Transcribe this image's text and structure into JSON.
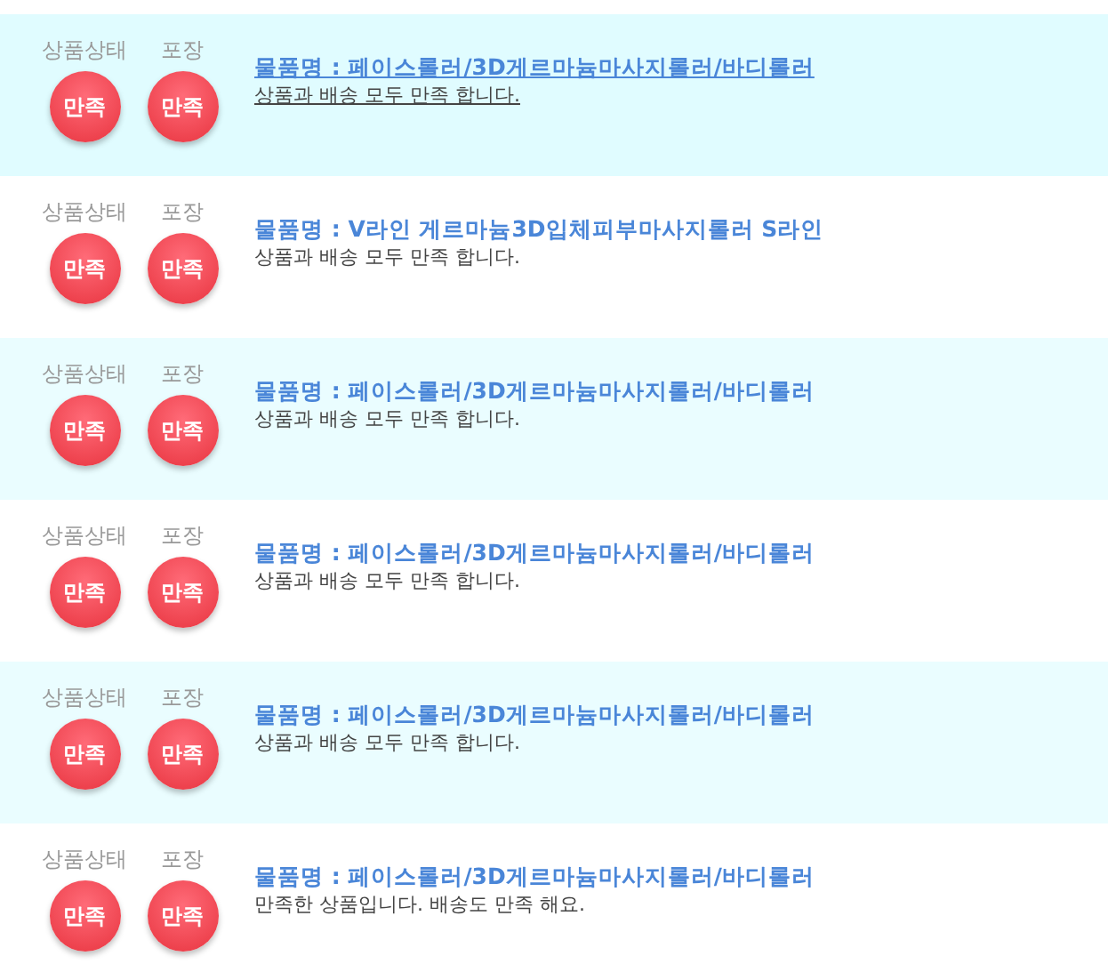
{
  "reviews": [
    {
      "highlighted": true,
      "ratings": [
        {
          "label": "상품상태",
          "value": "만족"
        },
        {
          "label": "포장",
          "value": "만족"
        }
      ],
      "product": "물품명 : 페이스롤러/3D게르마늄마사지롤러/바디롤러",
      "comment": "상품과 배송 모두 만족 합니다."
    },
    {
      "highlighted": false,
      "ratings": [
        {
          "label": "상품상태",
          "value": "만족"
        },
        {
          "label": "포장",
          "value": "만족"
        }
      ],
      "product": "물품명 : V라인 게르마늄3D입체피부마사지롤러 S라인",
      "comment": "상품과 배송 모두 만족 합니다."
    },
    {
      "highlighted": false,
      "ratings": [
        {
          "label": "상품상태",
          "value": "만족"
        },
        {
          "label": "포장",
          "value": "만족"
        }
      ],
      "product": "물품명 : 페이스롤러/3D게르마늄마사지롤러/바디롤러",
      "comment": "상품과 배송 모두 만족 합니다."
    },
    {
      "highlighted": false,
      "ratings": [
        {
          "label": "상품상태",
          "value": "만족"
        },
        {
          "label": "포장",
          "value": "만족"
        }
      ],
      "product": "물품명 : 페이스롤러/3D게르마늄마사지롤러/바디롤러",
      "comment": "상품과 배송 모두 만족 합니다."
    },
    {
      "highlighted": false,
      "ratings": [
        {
          "label": "상품상태",
          "value": "만족"
        },
        {
          "label": "포장",
          "value": "만족"
        }
      ],
      "product": "물품명 : 페이스롤러/3D게르마늄마사지롤러/바디롤러",
      "comment": "상품과 배송 모두 만족 합니다."
    },
    {
      "highlighted": false,
      "ratings": [
        {
          "label": "상품상태",
          "value": "만족"
        },
        {
          "label": "포장",
          "value": "만족"
        }
      ],
      "product": "물품명 : 페이스롤러/3D게르마늄마사지롤러/바디롤러",
      "comment": "만족한 상품입니다. 배송도 만족 해요."
    }
  ]
}
